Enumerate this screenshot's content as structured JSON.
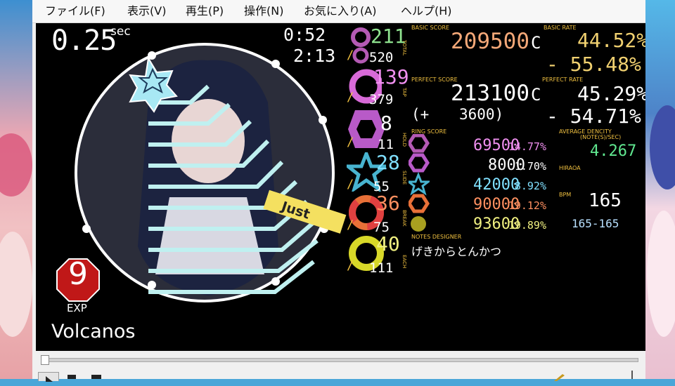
{
  "menu": [
    "ファイル(F)",
    "表示(V)",
    "再生(P)",
    "操作(N)",
    "お気に入り(A)",
    "ヘルプ(H)"
  ],
  "player": {
    "offset_value": "0.25",
    "offset_unit": "sec",
    "time_current": "0:52",
    "time_total": "2:13",
    "judge_text": "Just",
    "level": "9",
    "difficulty": "EXP",
    "song_title": "Volcanos"
  },
  "note_counts": [
    {
      "type": "total",
      "count": "211",
      "max": "520",
      "label": "TOTAL",
      "color": "#b45ab4"
    },
    {
      "type": "tap",
      "count": "139",
      "max": "379",
      "label": "TAP",
      "color": "#d86ad8"
    },
    {
      "type": "hold",
      "count": "8",
      "max": "11",
      "label": "HOLD",
      "color": "#b85ac8"
    },
    {
      "type": "slide",
      "count": "28",
      "max": "55",
      "label": "SLIDE",
      "color": "#48b4d0"
    },
    {
      "type": "break",
      "count": "36",
      "max": "75",
      "label": "BREAK",
      "color": "#e87038"
    },
    {
      "type": "each",
      "count": "40",
      "max": "111",
      "label": "EACH",
      "color": "#d8d828"
    }
  ],
  "basic_score": {
    "label": "BASIC SCORE",
    "value": "209500",
    "grade": "C"
  },
  "basic_rate": {
    "label": "BASIC RATE",
    "value": "44.52%",
    "remain": "- 55.48%"
  },
  "perfect_score": {
    "label": "PERFECT SCORE",
    "value": "213100",
    "grade": "C",
    "bonus_open": "(+",
    "bonus": "3600)"
  },
  "perfect_rate": {
    "label": "PERFECT RATE",
    "value": "45.29%",
    "remain": "- 54.71%"
  },
  "ring_score": {
    "label": "RING SCORE",
    "rows": [
      {
        "value": "69500",
        "percent": "14.77%",
        "color": "#d070d8"
      },
      {
        "value": "8000",
        "percent": "1.70%",
        "color": "#d070d8"
      },
      {
        "value": "42000",
        "percent": "8.92%",
        "color": "#40c0e0"
      },
      {
        "value": "90000",
        "percent": "19.12%",
        "color": "#f09040"
      },
      {
        "value": "93600",
        "percent": "19.89%",
        "color": "#e8d040"
      }
    ]
  },
  "average_density": {
    "label": "AVERAGE DENCITY",
    "sublabel": "(NOTE(S)/SEC)",
    "value": "4.267"
  },
  "hiraoa_label": "HIRAOA",
  "bpm": {
    "label": "BPM",
    "value": "165",
    "range": "165-165"
  },
  "notes_designer": {
    "label": "NOTES DESIGNER",
    "value": "げきからとんかつ"
  },
  "colors": {
    "basic_score": "#f4a878",
    "basic_rate": "#f0d070",
    "perfect": "#ffffff",
    "density": "#60e890",
    "judge": "#f4e060",
    "level_badge": "#c01818"
  }
}
